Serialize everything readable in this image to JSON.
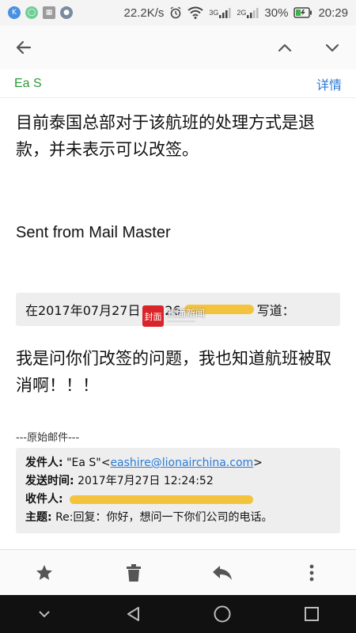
{
  "status_bar": {
    "net_speed": "22.2K/s",
    "signal1_label": "3G",
    "signal2_label": "2G",
    "battery": "30%",
    "time": "20:29",
    "app_icons": [
      "k-app-icon",
      "cloud-app-icon",
      "grid-app-icon",
      "globe-app-icon"
    ]
  },
  "toolbar": {
    "back_icon": "arrow-left-icon",
    "prev_icon": "chevron-up-icon",
    "next_icon": "chevron-down-icon"
  },
  "sender": {
    "name": "Ea S",
    "details_label": "详情"
  },
  "message": {
    "paragraph": "目前泰国总部对于该航班的处理方式是退款，并未表示可以改签。",
    "signature": "Sent from Mail Master"
  },
  "quote": {
    "header_prefix": "在2017年07月27日 13:26",
    "header_suffix": "写道："
  },
  "watermark": {
    "mark": "封面",
    "name": "封面新闻"
  },
  "reply": {
    "paragraph": "我是问你们改签的问题，我也知道航班被取消啊！！！"
  },
  "original": {
    "label": "---原始邮件---",
    "from_label": "发件人:",
    "from_name": "\"Ea S\"<",
    "from_email": "eashire@lionairchina.com",
    "from_close": ">",
    "sent_label": "发送时间:",
    "sent_value": "2017年7月27日 12:24:52",
    "to_label": "收件人:",
    "subject_label": "主题:",
    "subject_value": "Re:回复：你好，想问一下你们公司的电话。"
  },
  "colors": {
    "accent_green": "#2e9a3a",
    "link_blue": "#2a7ad6",
    "redaction": "#f3c33d"
  }
}
